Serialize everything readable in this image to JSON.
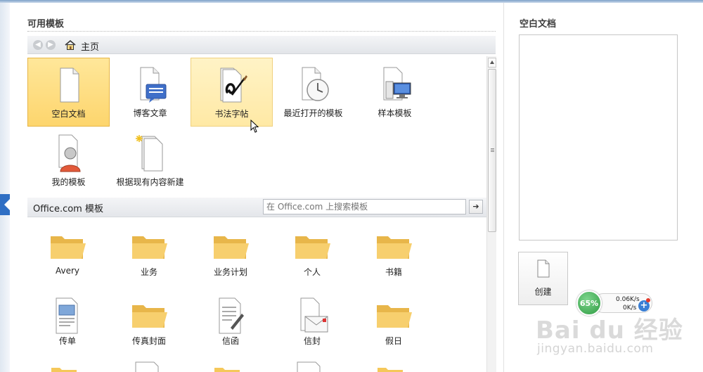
{
  "available_templates": {
    "title": "可用模板",
    "breadcrumb": "主页",
    "tiles": [
      {
        "label": "空白文档",
        "icon": "blank-document-icon"
      },
      {
        "label": "博客文章",
        "icon": "blog-post-icon"
      },
      {
        "label": "书法字帖",
        "icon": "calligraphy-icon"
      },
      {
        "label": "最近打开的模板",
        "icon": "recent-templates-icon"
      },
      {
        "label": "样本模板",
        "icon": "sample-templates-icon"
      },
      {
        "label": "我的模板",
        "icon": "my-templates-icon"
      },
      {
        "label": "根据现有内容新建",
        "icon": "new-from-existing-icon"
      }
    ]
  },
  "office": {
    "title": "Office.com 模板",
    "search_placeholder": "在 Office.com 上搜索模板",
    "go_symbol": "➔",
    "items": [
      {
        "label": "Avery",
        "icon": "folder-icon"
      },
      {
        "label": "业务",
        "icon": "folder-icon"
      },
      {
        "label": "业务计划",
        "icon": "folder-icon"
      },
      {
        "label": "个人",
        "icon": "folder-icon"
      },
      {
        "label": "书籍",
        "icon": "folder-icon"
      },
      {
        "label": "传单",
        "icon": "flyer-icon"
      },
      {
        "label": "传真封面",
        "icon": "folder-icon"
      },
      {
        "label": "信函",
        "icon": "letter-icon"
      },
      {
        "label": "信封",
        "icon": "envelope-icon"
      },
      {
        "label": "假日",
        "icon": "folder-icon"
      }
    ]
  },
  "preview": {
    "title": "空白文档",
    "create_label": "创建"
  },
  "network_widget": {
    "percent": "65%",
    "upload": "0.06K/s",
    "download": "0K/s"
  },
  "watermark": {
    "brand": "Bai du 经验",
    "url": "jingyan.baidu.com"
  },
  "colors": {
    "selected": "#fdd56d",
    "hover": "#ffe9a5",
    "folder": "#f5c85a",
    "accent": "#2f6fc4"
  }
}
